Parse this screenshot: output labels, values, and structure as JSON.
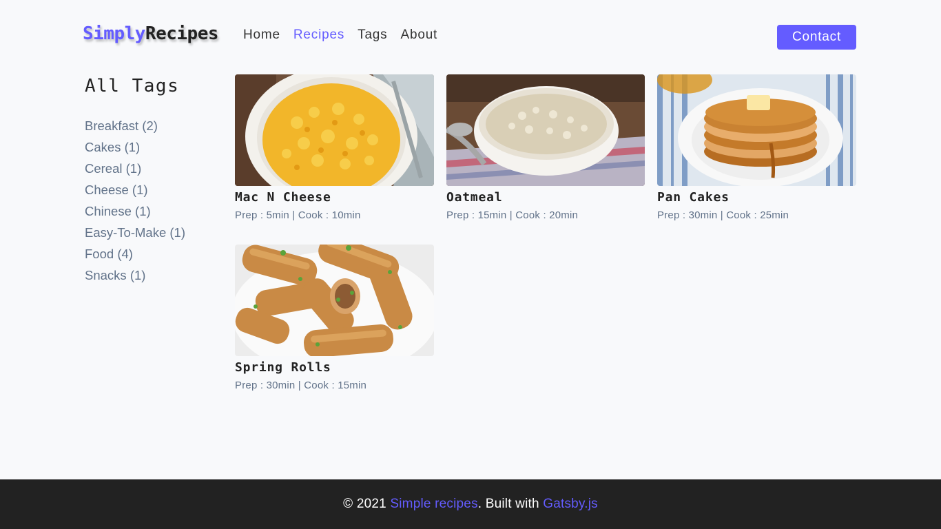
{
  "nav": {
    "logo_part1": "Simply",
    "logo_part2": "Recipes",
    "links": [
      {
        "label": "Home",
        "active": false
      },
      {
        "label": "Recipes",
        "active": true
      },
      {
        "label": "Tags",
        "active": false
      },
      {
        "label": "About",
        "active": false
      }
    ],
    "contact_label": "Contact"
  },
  "sidebar": {
    "title": "All Tags",
    "tags": [
      {
        "name": "Breakfast",
        "count": "(2)"
      },
      {
        "name": "Cakes",
        "count": "(1)"
      },
      {
        "name": "Cereal",
        "count": "(1)"
      },
      {
        "name": "Cheese",
        "count": "(1)"
      },
      {
        "name": "Chinese",
        "count": "(1)"
      },
      {
        "name": "Easy-To-Make",
        "count": "(1)"
      },
      {
        "name": "Food",
        "count": "(4)"
      },
      {
        "name": "Snacks",
        "count": "(1)"
      }
    ]
  },
  "recipes": [
    {
      "title": "Mac N Cheese",
      "meta": "Prep : 5min | Cook : 10min",
      "image": "mac-n-cheese-photo"
    },
    {
      "title": "Oatmeal",
      "meta": "Prep : 15min | Cook : 20min",
      "image": "oatmeal-photo"
    },
    {
      "title": "Pan Cakes",
      "meta": "Prep : 30min | Cook : 25min",
      "image": "pancakes-photo"
    },
    {
      "title": "Spring Rolls",
      "meta": "Prep : 30min | Cook : 15min",
      "image": "spring-rolls-photo"
    }
  ],
  "footer": {
    "prefix": "© 2021 ",
    "site_link": "Simple recipes",
    "middle": ". Built with ",
    "gatsby_link": "Gatsby.js"
  },
  "colors": {
    "accent": "#645cff",
    "footer_bg": "#222222",
    "page_bg": "#f8f9fb",
    "muted_text": "#617289"
  }
}
